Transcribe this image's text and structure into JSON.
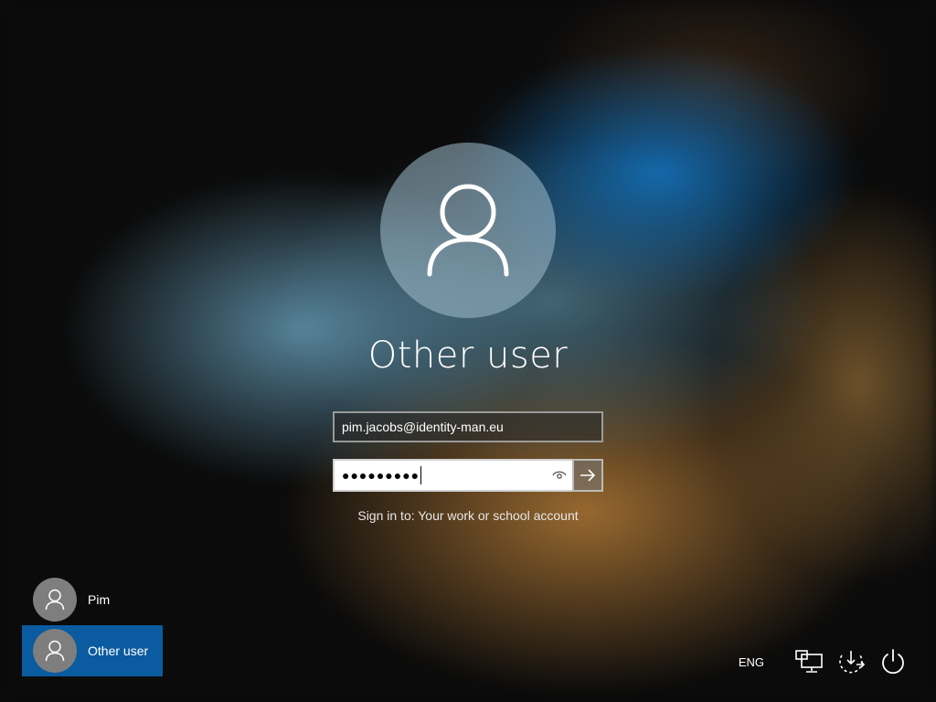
{
  "login": {
    "title": "Other user",
    "email_value": "pim.jacobs@identity-man.eu",
    "password_masked": "●●●●●●●●●",
    "sign_in_note": "Sign in to: Your work or school account"
  },
  "user_list": [
    {
      "name": "Pim",
      "selected": false
    },
    {
      "name": "Other user",
      "selected": true
    }
  ],
  "system_tray": {
    "language": "ENG"
  },
  "icons": {
    "avatar": "person-icon",
    "reveal_password": "eye-icon",
    "submit": "arrow-right-icon",
    "network": "network-icon",
    "ease_of_access": "ease-of-access-icon",
    "power": "power-icon"
  },
  "colors": {
    "selected_user_bg": "#0a5ba0",
    "avatar_big_bg": "#a0becd",
    "small_avatar_bg": "#7e7e7e"
  }
}
